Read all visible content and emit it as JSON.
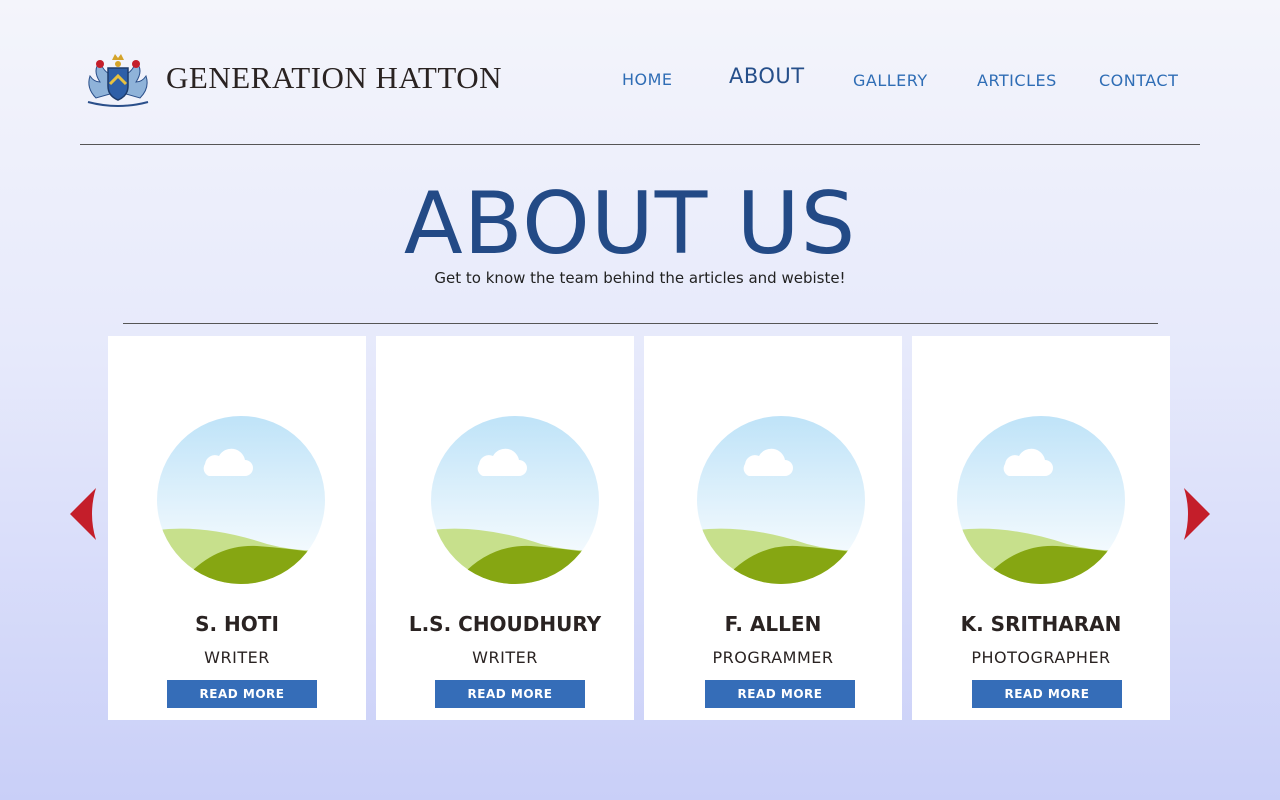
{
  "header": {
    "brand": "GENERATION HATTON",
    "nav": {
      "home": "HOME",
      "about": "ABOUT",
      "gallery": "GALLERY",
      "articles": "ARTICLES",
      "contact": "CONTACT"
    }
  },
  "hero": {
    "title": "ABOUT US",
    "subtitle": "Get to know the team behind the articles and webiste!"
  },
  "team": [
    {
      "name": "S. HOTI",
      "role": "WRITER",
      "button": "READ MORE"
    },
    {
      "name": "L.S. CHOUDHURY",
      "role": "WRITER",
      "button": "READ MORE"
    },
    {
      "name": "F. ALLEN",
      "role": "PROGRAMMER",
      "button": "READ MORE"
    },
    {
      "name": "K. SRITHARAN",
      "role": "PHOTOGRAPHER",
      "button": "READ MORE"
    }
  ],
  "colors": {
    "accent": "#356db8",
    "title": "#234a86",
    "arrow": "#c41e2a"
  }
}
